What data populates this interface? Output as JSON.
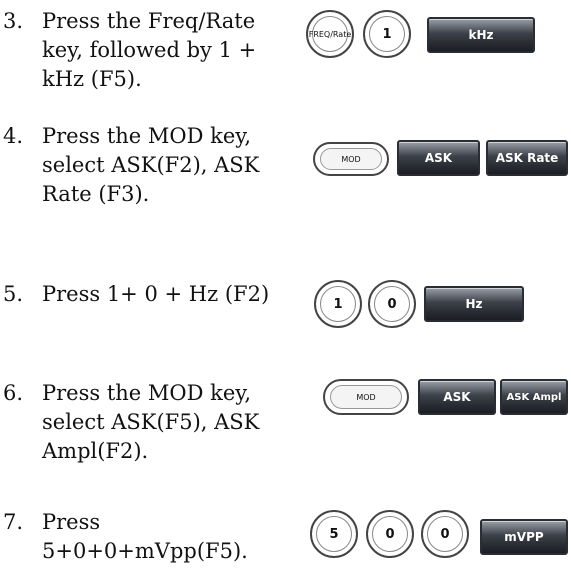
{
  "steps": [
    {
      "num": "3.",
      "text": "Press the Freq/Rate key, followed by 1 + kHz (F5).",
      "keys": [
        "FREQ/Rate",
        "1",
        "kHz"
      ]
    },
    {
      "num": "4.",
      "text": "Press the MOD key, select ASK(F2), ASK Rate (F3).",
      "keys": [
        "MOD",
        "ASK",
        "ASK Rate"
      ]
    },
    {
      "num": "5.",
      "text": "Press 1+ 0 + Hz (F2)",
      "keys": [
        "1",
        "0",
        "Hz"
      ]
    },
    {
      "num": "6.",
      "text": "Press the MOD key, select ASK(F5), ASK Ampl(F2).",
      "keys": [
        "MOD",
        "ASK",
        "ASK Ampl"
      ]
    },
    {
      "num": "7.",
      "text": "Press 5+0+0+mVpp(F5).",
      "keys": [
        "5",
        "0",
        "0",
        "mVPP"
      ]
    }
  ]
}
